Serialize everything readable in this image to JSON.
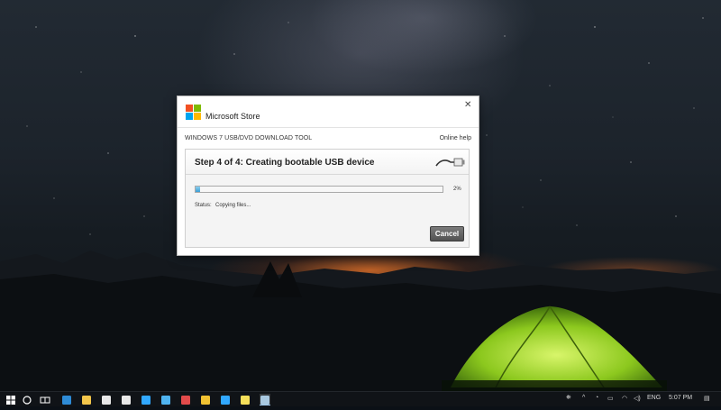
{
  "dialog": {
    "app_title": "Microsoft Store",
    "close_glyph": "✕",
    "tool_title": "WINDOWS 7 USB/DVD DOWNLOAD TOOL",
    "help_link": "Online help",
    "step_title": "Step 4 of 4: Creating bootable USB device",
    "progress": {
      "value_percent": 2,
      "label": "2%"
    },
    "status_label": "Status:",
    "status_value": "Copying files...",
    "cancel_label": "Cancel",
    "logo_colors": [
      "#f25022",
      "#7fba00",
      "#00a4ef",
      "#ffb900"
    ]
  },
  "taskbar": {
    "apps": [
      {
        "name": "start-icon",
        "color": "#ffffff"
      },
      {
        "name": "cortana-icon",
        "color": "#ffffff"
      },
      {
        "name": "task-view-icon",
        "color": "#ffffff"
      },
      {
        "name": "edge-icon",
        "color": "#2e8bd6"
      },
      {
        "name": "file-explorer-icon",
        "color": "#f3c64b"
      },
      {
        "name": "store-icon",
        "color": "#e8e8e8"
      },
      {
        "name": "mail-icon",
        "color": "#e8e8e8"
      },
      {
        "name": "photoshop-icon",
        "color": "#31a8ff"
      },
      {
        "name": "app-icon",
        "color": "#4fb3f0"
      },
      {
        "name": "app-icon-red",
        "color": "#e24b4b"
      },
      {
        "name": "chrome-icon",
        "color": "#f1c232"
      },
      {
        "name": "photoshop-icon-2",
        "color": "#31a8ff"
      },
      {
        "name": "sticky-notes-icon",
        "color": "#f7e05b"
      },
      {
        "name": "usb-tool-icon",
        "color": "#a8c8e0"
      }
    ],
    "tray": {
      "language": "ENG",
      "time": "5:07 PM"
    }
  }
}
